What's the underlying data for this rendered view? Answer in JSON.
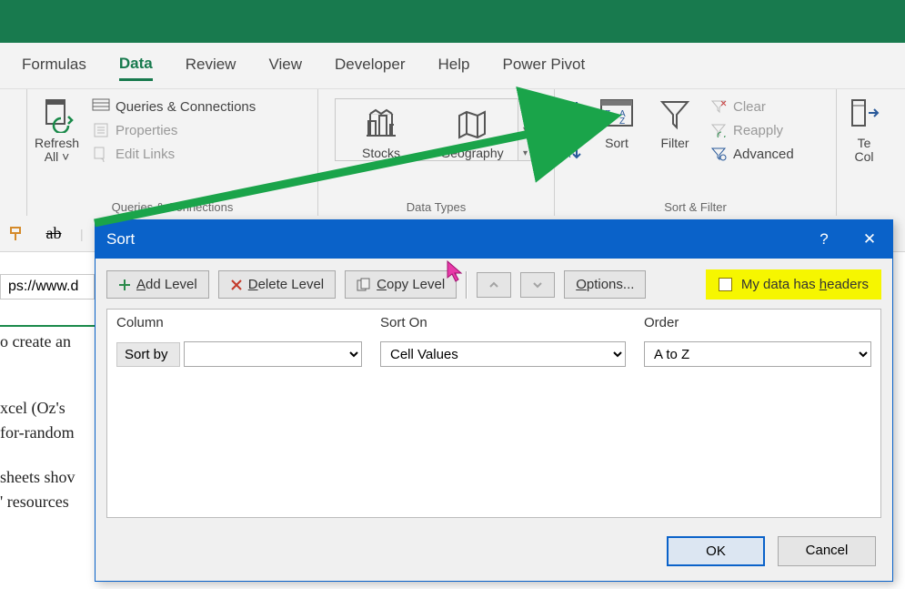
{
  "ribbon": {
    "tabs": [
      "Formulas",
      "Data",
      "Review",
      "View",
      "Developer",
      "Help",
      "Power Pivot"
    ],
    "active_tab": "Data",
    "groups": {
      "queries": {
        "refresh_label": "Refresh\nAll",
        "q_conn": "Queries & Connections",
        "properties": "Properties",
        "edit_links": "Edit Links",
        "group_label": "Queries & Connections"
      },
      "datatypes": {
        "stocks": "Stocks",
        "geography": "Geography",
        "group_label": "Data Types"
      },
      "sortfilter": {
        "sort": "Sort",
        "filter": "Filter",
        "clear": "Clear",
        "reapply": "Reapply",
        "advanced": "Advanced",
        "group_label": "Sort & Filter"
      },
      "texttocols": {
        "label": "Te\nCol"
      }
    }
  },
  "sheet": {
    "address_value": "ps://www.d",
    "line_create": "o create an",
    "line_bold": "xcel (Oz's ",
    "line_link": "for-random",
    "line_sheets": "sheets shov",
    "line_resources": "' resources"
  },
  "dialog": {
    "title": "Sort",
    "help_glyph": "?",
    "close_glyph": "✕",
    "toolbar": {
      "add_label": "Add Level",
      "delete_label": "Delete Level",
      "copy_label": "Copy Level",
      "options_label": "Options...",
      "headers_label": "My data has headers"
    },
    "columns": {
      "col_hdr": "Column",
      "sorton_hdr": "Sort On",
      "order_hdr": "Order",
      "sortby_label": "Sort by",
      "sorton_value": "Cell Values",
      "order_value": "A to Z"
    },
    "footer": {
      "ok": "OK",
      "cancel": "Cancel"
    }
  }
}
